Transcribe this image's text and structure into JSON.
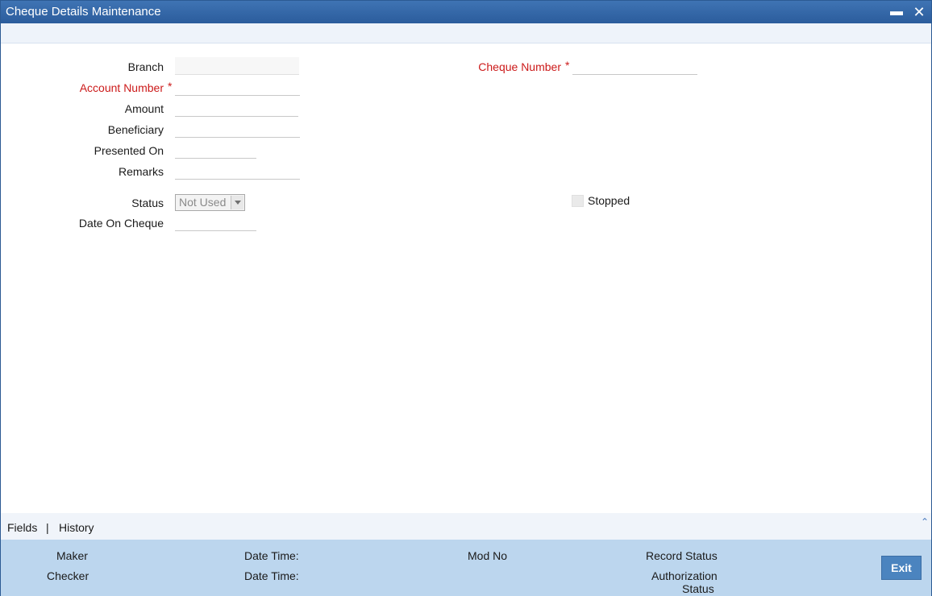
{
  "window": {
    "title": "Cheque Details Maintenance",
    "minimize_glyph": "▬",
    "close_glyph": "✕"
  },
  "form": {
    "branch": {
      "label": "Branch",
      "value": ""
    },
    "account_number": {
      "label": "Account Number",
      "required": "*",
      "value": ""
    },
    "amount": {
      "label": "Amount",
      "value": ""
    },
    "beneficiary": {
      "label": "Beneficiary",
      "value": ""
    },
    "presented_on": {
      "label": "Presented On",
      "value": ""
    },
    "remarks": {
      "label": "Remarks",
      "value": ""
    },
    "status": {
      "label": "Status",
      "selected": "Not Used"
    },
    "date_on_cheque": {
      "label": "Date On Cheque",
      "value": ""
    },
    "cheque_number": {
      "label": "Cheque Number",
      "required": "*",
      "value": ""
    },
    "stopped": {
      "label": "Stopped",
      "checked": false
    }
  },
  "links": {
    "fields": "Fields",
    "separator": "|",
    "history": "History",
    "collapse_glyph": "⌃"
  },
  "audit": {
    "maker": "Maker",
    "checker": "Checker",
    "date_time_1": "Date Time:",
    "date_time_2": "Date Time:",
    "mod_no": "Mod No",
    "record_status": "Record Status",
    "authorization": "Authorization",
    "authorization_status": "Status",
    "exit": "Exit"
  }
}
